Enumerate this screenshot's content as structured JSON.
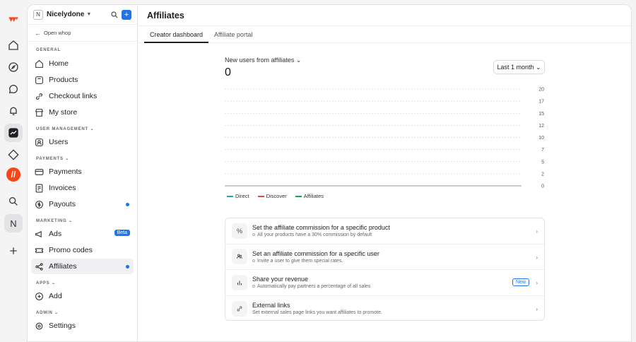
{
  "sidebar": {
    "workspace_badge": "N",
    "workspace_name": "Nicelydone",
    "open_whop": "Open whop",
    "sections": {
      "general": "GENERAL",
      "user_management": "USER MANAGEMENT",
      "payments": "PAYMENTS",
      "marketing": "MARKETING",
      "apps": "APPS",
      "admin": "ADMIN"
    },
    "items": {
      "home": "Home",
      "products": "Products",
      "checkout_links": "Checkout links",
      "my_store": "My store",
      "users": "Users",
      "payments": "Payments",
      "invoices": "Invoices",
      "payouts": "Payouts",
      "ads": "Ads",
      "ads_badge": "Beta",
      "promo_codes": "Promo codes",
      "affiliates": "Affiliates",
      "add": "Add",
      "settings": "Settings"
    }
  },
  "rail": {
    "n_label": "N"
  },
  "header": {
    "title": "Affiliates"
  },
  "tabs": [
    "Creator dashboard",
    "Affiliate portal"
  ],
  "metric": {
    "label": "New users from affiliates",
    "value": "0"
  },
  "range": {
    "label": "Last 1 month"
  },
  "colors": {
    "accent": "#1e74e8",
    "direct": "#19a7c9",
    "discover": "#e8482f",
    "affiliates": "#1f9d55"
  },
  "chart_data": {
    "type": "line",
    "y_ticks": [
      "20",
      "17",
      "15",
      "12",
      "10",
      "7",
      "5",
      "2",
      "0"
    ],
    "ylim": [
      0,
      20
    ],
    "series": [
      {
        "name": "Direct",
        "values": []
      },
      {
        "name": "Discover",
        "values": []
      },
      {
        "name": "Affiliates",
        "values": []
      }
    ],
    "grid": true,
    "legend_position": "bottom-left"
  },
  "cards": [
    {
      "title": "Set the affiliate commission for a specific product",
      "subtitle": "All your products have a 30% commission by default",
      "icon": "percent-icon"
    },
    {
      "title": "Set an affiliate commission for a specific user",
      "subtitle": "Invite a user to give them special rates.",
      "icon": "users-icon"
    },
    {
      "title": "Share your revenue",
      "subtitle": "Automatically pay partners a percentage of all sales",
      "badge": "New",
      "icon": "bar-chart-icon"
    },
    {
      "title": "External links",
      "subtitle": "Set external sales page links you want affiliates to promote.",
      "icon": "link-icon"
    }
  ]
}
